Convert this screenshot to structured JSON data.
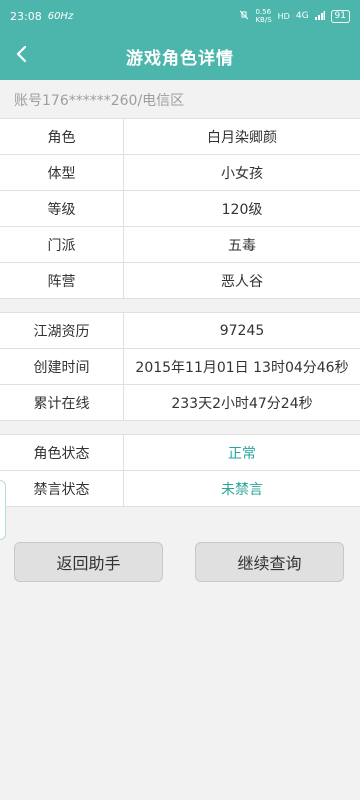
{
  "status_bar": {
    "time": "23:08",
    "refresh_rate": "60Hz",
    "net_speed": "0.56\nKB/S",
    "hd_badge": "HD",
    "network": "4G",
    "battery": "91"
  },
  "header": {
    "title": "游戏角色详情"
  },
  "account": {
    "text": "账号176******260/电信区"
  },
  "sections": {
    "basic": [
      {
        "label": "角色",
        "value": "白月染卿颜"
      },
      {
        "label": "体型",
        "value": "小女孩"
      },
      {
        "label": "等级",
        "value": "120级"
      },
      {
        "label": "门派",
        "value": "五毒"
      },
      {
        "label": "阵营",
        "value": "恶人谷"
      }
    ],
    "history": [
      {
        "label": "江湖资历",
        "value": "97245"
      },
      {
        "label": "创建时间",
        "value": "2015年11月01日 13时04分46秒"
      },
      {
        "label": "累计在线",
        "value": "233天2小时47分24秒"
      }
    ],
    "status": [
      {
        "label": "角色状态",
        "value": "正常"
      },
      {
        "label": "禁言状态",
        "value": "未禁言"
      }
    ]
  },
  "buttons": {
    "back_label": "返回助手",
    "continue_label": "继续查询"
  },
  "colors": {
    "accent": "#4db6ac",
    "status_green": "#26a69a"
  },
  "icons": {
    "back": "chevron-left-icon"
  }
}
